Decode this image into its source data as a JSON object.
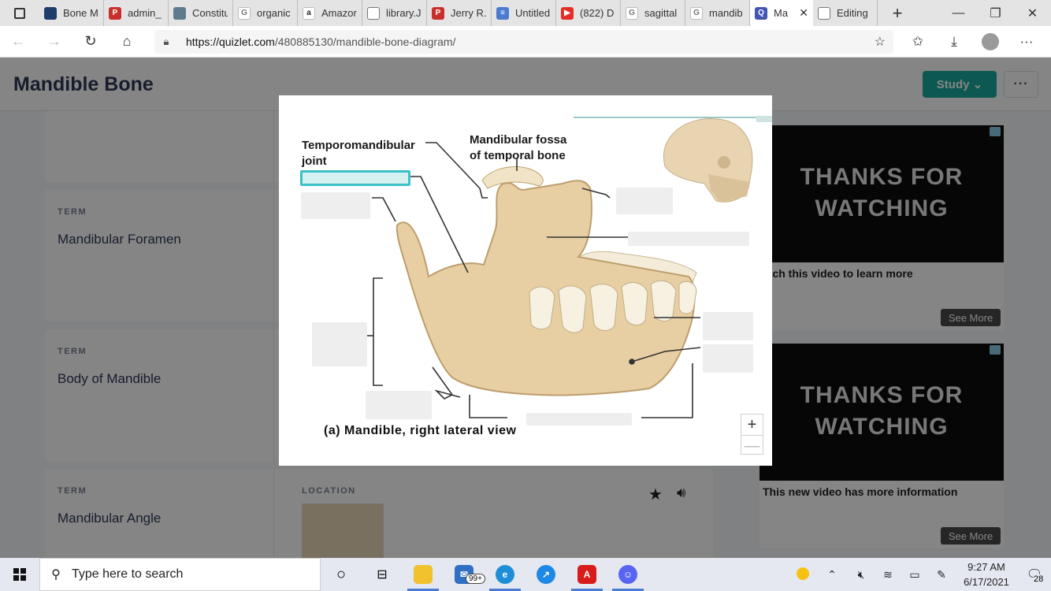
{
  "browser": {
    "tabs": [
      {
        "label": "Bone M",
        "icon": "bookmark-icon",
        "color": "#1f3d6b"
      },
      {
        "label": "admin_",
        "icon": "pdf-icon",
        "color": "#c9302c"
      },
      {
        "label": "Constitu",
        "icon": "document-icon",
        "color": "#5f7a8c"
      },
      {
        "label": "organic",
        "icon": "google-icon",
        "color": "#ffffff"
      },
      {
        "label": "Amazor",
        "icon": "amazon-icon",
        "color": "#ffffff"
      },
      {
        "label": "library.J",
        "icon": "page-icon",
        "color": "#ffffff"
      },
      {
        "label": "Jerry R.",
        "icon": "pdf-icon",
        "color": "#c9302c"
      },
      {
        "label": "Untitled",
        "icon": "docs-icon",
        "color": "#4a7bd1"
      },
      {
        "label": "(822) D",
        "icon": "youtube-icon",
        "color": "#e52d27"
      },
      {
        "label": "sagittal",
        "icon": "google-icon",
        "color": "#ffffff"
      },
      {
        "label": "mandib",
        "icon": "google-icon",
        "color": "#ffffff"
      },
      {
        "label": "Ma",
        "icon": "quizlet-icon",
        "color": "#4257b2",
        "active": true
      },
      {
        "label": "Editing",
        "icon": "editor-icon",
        "color": "#ffffff"
      }
    ],
    "url_host": "https://quizlet.com",
    "url_path": "/480885130/mandible-bone-diagram/"
  },
  "page": {
    "title": "Mandible Bone",
    "study_label": "Study",
    "more_label": "···",
    "cards": [
      {
        "term_label": "TERM",
        "term": "Mandibular Foramen"
      },
      {
        "term_label": "TERM",
        "term": "Body of Mandible"
      },
      {
        "term_label": "TERM",
        "term": "Mandibular Angle",
        "location_label": "LOCATION"
      }
    ],
    "ads": [
      {
        "video_text": "THANKS FOR WATCHING",
        "caption": "atch this video to learn more",
        "button": "See More"
      },
      {
        "video_text": "THANKS FOR WATCHING",
        "caption": "This new video has more information",
        "button": "See More"
      }
    ]
  },
  "modal": {
    "label_tmj_line1": "Temporomandibular",
    "label_tmj_line2": "joint",
    "label_fossa_line1": "Mandibular fossa",
    "label_fossa_line2": "of temporal bone",
    "caption": "(a) Mandible, right lateral view",
    "zoom_in": "+",
    "zoom_out": "—"
  },
  "taskbar": {
    "search_placeholder": "Type here to search",
    "mail_badge": "99+",
    "time": "9:27 AM",
    "date": "6/17/2021",
    "notifications": "28"
  }
}
